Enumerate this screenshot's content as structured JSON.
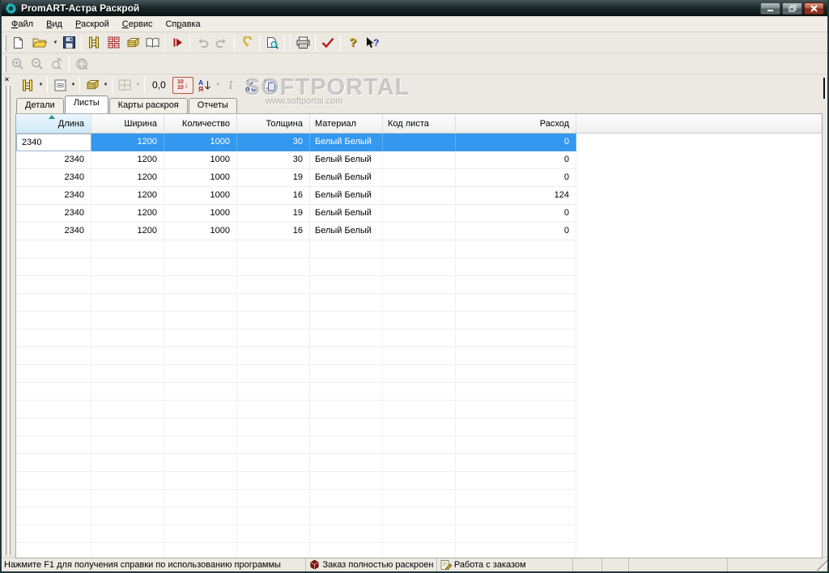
{
  "window": {
    "title": "PromART-Астра Раскрой",
    "controls": {
      "minimize": "minimize",
      "restore": "restore",
      "close": "close"
    }
  },
  "menu": {
    "items": [
      {
        "pre": "",
        "key": "Ф",
        "post": "айл"
      },
      {
        "pre": "",
        "key": "В",
        "post": "ид"
      },
      {
        "pre": "",
        "key": "Р",
        "post": "аскрой"
      },
      {
        "pre": "",
        "key": "С",
        "post": "ервис"
      },
      {
        "pre": "Сп",
        "key": "р",
        "post": "авка"
      }
    ]
  },
  "toolbar_main": {
    "icons": [
      "new-document-icon",
      "open-folder-icon",
      "save-icon",
      "details-view-icon",
      "sheets-view-icon",
      "layouts-view-icon",
      "catalog-book-icon",
      "run-icon",
      "undo-icon",
      "redo-icon",
      "restore-hook-icon",
      "print-preview-icon",
      "print-icon",
      "check-icon",
      "help-icon",
      "context-help-icon"
    ]
  },
  "toolbar_zoom": {
    "icons": [
      "zoom-in-icon",
      "zoom-out-icon",
      "zoom-dynamic-icon",
      "zoom-page-icon"
    ]
  },
  "toolbar_grid": {
    "coords_label": "0,0",
    "precision_top": "10",
    "precision_bottom": "10",
    "sort_letter_top": "А",
    "sort_letter_bottom": "Я",
    "icons": [
      "details-icon",
      "card-style-icon",
      "material-icon",
      "grid-layout-icon",
      "precision-toggle-icon",
      "sort-icon",
      "info-icon",
      "cut-icon",
      "copy-icon"
    ]
  },
  "watermark": {
    "title": "SOFTPORTAL",
    "url": "www.softportal.com"
  },
  "tabs": {
    "items": [
      {
        "label": "Детали",
        "active": false
      },
      {
        "label": "Листы",
        "active": true
      },
      {
        "label": "Карты раскроя",
        "active": false
      },
      {
        "label": "Отчеты",
        "active": false
      }
    ]
  },
  "table": {
    "columns": [
      {
        "label": "Длина",
        "width": 93,
        "align": "right",
        "sorted": true
      },
      {
        "label": "Ширина",
        "width": 90,
        "align": "right",
        "sorted": false
      },
      {
        "label": "Количество",
        "width": 90,
        "align": "right",
        "sorted": false
      },
      {
        "label": "Толщина",
        "width": 90,
        "align": "right",
        "sorted": false
      },
      {
        "label": "Материал",
        "width": 90,
        "align": "left",
        "sorted": false
      },
      {
        "label": "Код листа",
        "width": 90,
        "align": "left",
        "sorted": false
      },
      {
        "label": "Расход",
        "width": 149,
        "align": "right",
        "sorted": false
      }
    ],
    "rows": [
      [
        "2340",
        "1200",
        "1000",
        "30",
        "Белый Белый",
        "",
        "0"
      ],
      [
        "2340",
        "1200",
        "1000",
        "30",
        "Белый Белый",
        "",
        "0"
      ],
      [
        "2340",
        "1200",
        "1000",
        "19",
        "Белый Белый",
        "",
        "0"
      ],
      [
        "2340",
        "1200",
        "1000",
        "16",
        "Белый Белый",
        "",
        "124"
      ],
      [
        "2340",
        "1200",
        "1000",
        "19",
        "Белый Белый",
        "",
        "0"
      ],
      [
        "2340",
        "1200",
        "1000",
        "16",
        "Белый Белый",
        "",
        "0"
      ]
    ],
    "selected_row": 0,
    "editing_cell": {
      "row": 0,
      "col": 0
    }
  },
  "statusbar": {
    "panels": [
      {
        "text": "Нажмите F1 для получения справки по использованию программы"
      },
      {
        "icon": "order-cube-icon",
        "text": "Заказ полностью раскроен"
      },
      {
        "icon": "work-note-icon",
        "text": "Работа с заказом"
      },
      {
        "text": ""
      },
      {
        "text": ""
      },
      {
        "text": ""
      },
      {
        "text": ""
      }
    ]
  },
  "colors": {
    "selection": "#3498f0",
    "titlebar_top": "#46565a",
    "titlebar_bottom": "#091111",
    "close_button": "#b0513a",
    "chrome": "#ece9e2",
    "sorted_header": "#d9eefb"
  }
}
